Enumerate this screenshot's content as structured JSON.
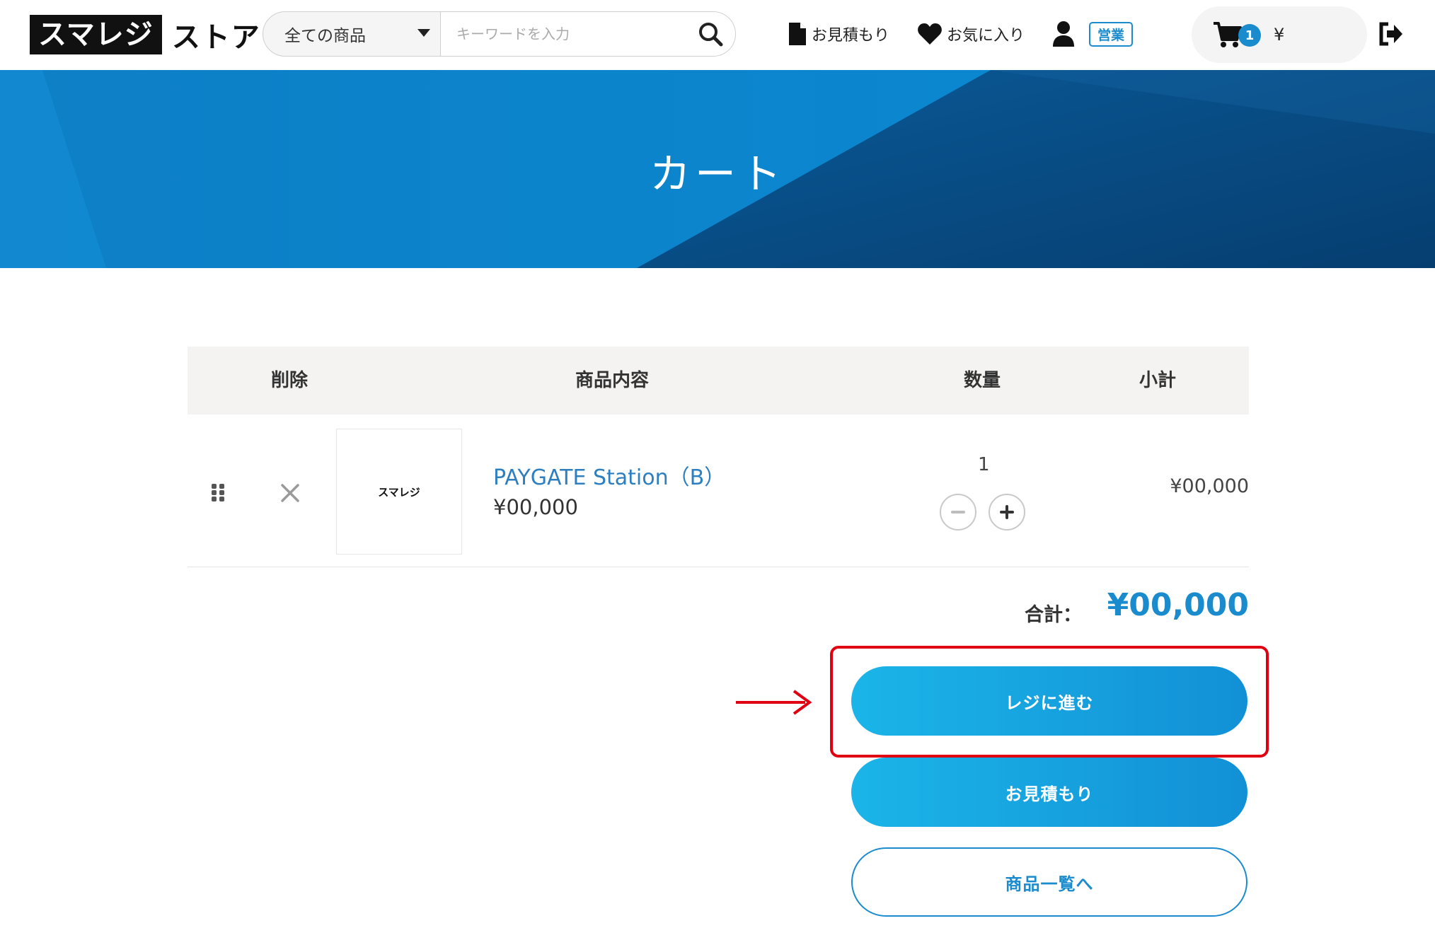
{
  "header": {
    "logo_box": "スマレジ",
    "logo_text": "ストア",
    "search": {
      "category": "全ての商品",
      "placeholder": "キーワードを入力",
      "value": ""
    },
    "nav": {
      "quote_label": "お見積もり",
      "favorites_label": "お気に入り",
      "role_badge": "営業"
    },
    "cart": {
      "count": "1",
      "amount": "¥"
    }
  },
  "hero": {
    "title": "カート"
  },
  "table": {
    "headers": {
      "delete": "削除",
      "item": "商品内容",
      "quantity": "数量",
      "subtotal": "小計"
    },
    "rows": [
      {
        "thumb_text": "スマレジ",
        "name": "PAYGATE Station（B）",
        "price": "¥00,000",
        "quantity": "1",
        "subtotal": "¥00,000"
      }
    ]
  },
  "summary": {
    "total_label": "合計：",
    "total_value": "¥00,000"
  },
  "buttons": {
    "checkout": "レジに進む",
    "quote": "お見積もり",
    "product_list": "商品一覧へ"
  },
  "colors": {
    "accent": "#1a8bcc",
    "highlight": "#e00012"
  }
}
